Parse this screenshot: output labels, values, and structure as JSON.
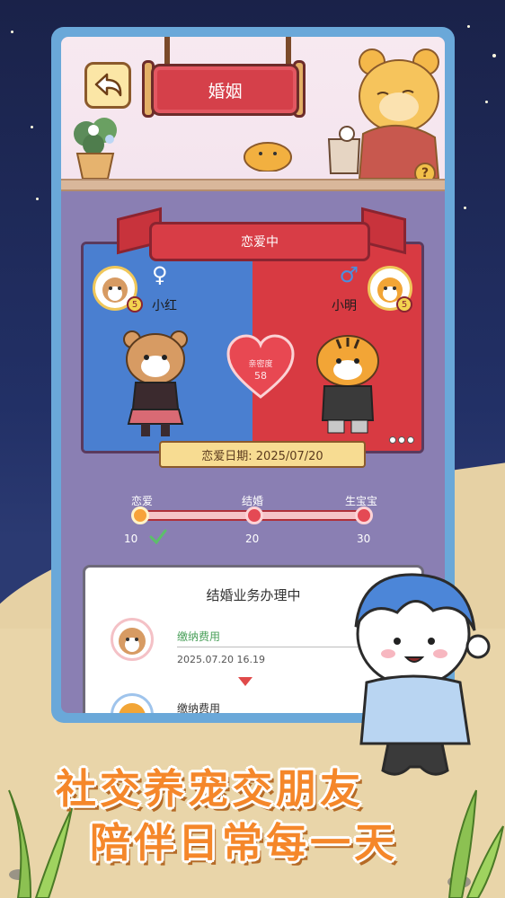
{
  "header": {
    "title": "婚姻",
    "back_icon": "back-arrow-icon",
    "help_label": "?"
  },
  "relationship": {
    "status": "恋爱中",
    "left": {
      "name": "小红",
      "gender_symbol": "♀",
      "level": "5"
    },
    "right": {
      "name": "小明",
      "gender_symbol": "♂",
      "level": "5"
    },
    "intimacy_label": "亲密度",
    "intimacy_value": "58",
    "date_label": "恋爱日期: 2025/07/20"
  },
  "progress": {
    "stages": [
      {
        "label": "恋爱",
        "threshold": "10",
        "done": true
      },
      {
        "label": "结婚",
        "threshold": "20",
        "done": false
      },
      {
        "label": "生宝宝",
        "threshold": "30",
        "done": false
      }
    ],
    "fraction": 0.0
  },
  "process_panel": {
    "title": "结婚业务办理中",
    "steps": [
      {
        "text": "缴纳费用",
        "time": "2025.07.20 16.19",
        "done": true
      },
      {
        "text": "缴纳费用",
        "time": "",
        "done": false
      }
    ]
  },
  "slogan": {
    "line1": "社交养宠交朋友",
    "line2": "陪伴日常每一天"
  },
  "colors": {
    "accent_red": "#d83a42",
    "accent_blue": "#4a7fd0",
    "slogan_orange": "#f5872a"
  }
}
